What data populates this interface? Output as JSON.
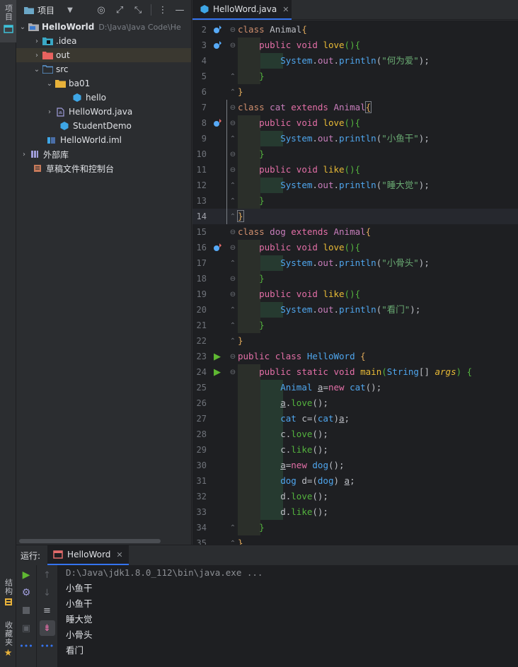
{
  "left_strip": {
    "project_tab": "项目",
    "structure_tab": "结构",
    "favorites_tab": "收藏夹"
  },
  "project_panel": {
    "title": "项目",
    "tree": [
      {
        "label": "HelloWorld",
        "hint": "D:\\Java\\Java Code\\He",
        "icon": "module-folder-icon"
      },
      {
        "label": ".idea",
        "icon": "idea-folder-icon"
      },
      {
        "label": "out",
        "icon": "out-folder-icon"
      },
      {
        "label": "src",
        "icon": "source-folder-icon"
      },
      {
        "label": "ba01",
        "icon": "package-folder-icon"
      },
      {
        "label": "hello",
        "icon": "class-icon"
      },
      {
        "label": "HelloWord.java",
        "icon": "java-file-icon"
      },
      {
        "label": "StudentDemo",
        "icon": "class-icon"
      },
      {
        "label": "HelloWorld.iml",
        "icon": "iml-file-icon"
      },
      {
        "label": "外部库",
        "icon": "library-icon"
      },
      {
        "label": "草稿文件和控制台",
        "icon": "scratches-icon"
      }
    ]
  },
  "editor": {
    "tab_label": "HelloWord.java",
    "current_line": 14,
    "line_numbers": [
      "2",
      "3",
      "4",
      "5",
      "6",
      "7",
      "8",
      "9",
      "10",
      "11",
      "12",
      "13",
      "14",
      "15",
      "16",
      "17",
      "18",
      "19",
      "20",
      "21",
      "22",
      "23",
      "24",
      "25",
      "26",
      "27",
      "28",
      "29",
      "30",
      "31",
      "32",
      "33",
      "34",
      "35"
    ],
    "strings": {
      "s1": "\"何为爱\"",
      "s2": "\"小鱼干\"",
      "s3": "\"睡大觉\"",
      "s4": "\"小骨头\"",
      "s5": "\"看门\""
    }
  },
  "run_panel": {
    "label": "运行:",
    "tab_label": "HelloWord",
    "command": "D:\\Java\\jdk1.8.0_112\\bin\\java.exe ...",
    "output": [
      "小鱼干",
      "小鱼干",
      "睡大觉",
      "小骨头",
      "看门"
    ]
  },
  "colors": {
    "accent": "#3574f0",
    "run_green": "#5fb832"
  }
}
